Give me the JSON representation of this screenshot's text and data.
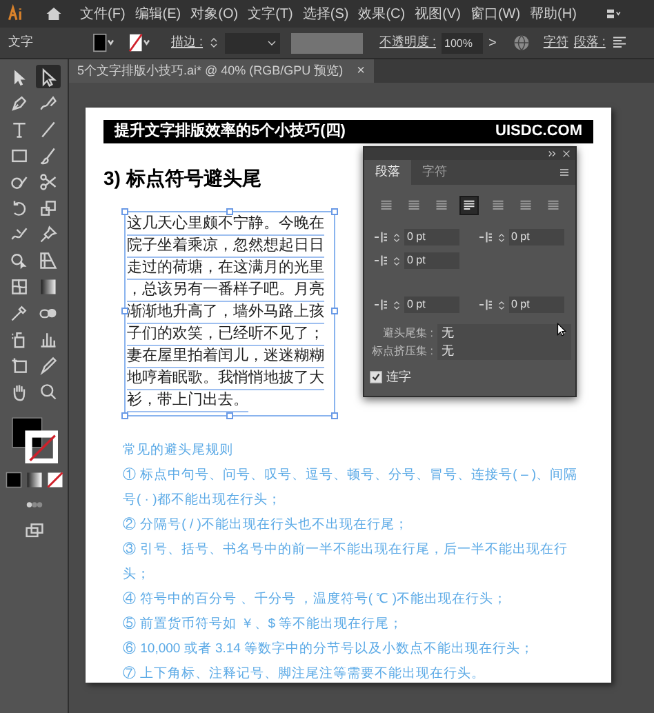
{
  "menu_bar": {
    "items": [
      "文件(F)",
      "编辑(E)",
      "对象(O)",
      "文字(T)",
      "选择(S)",
      "效果(C)",
      "视图(V)",
      "窗口(W)",
      "帮助(H)"
    ]
  },
  "control_bar": {
    "label": "文字",
    "stroke_label": "描边 :",
    "opacity_label": "不透明度 :",
    "opacity": "100%",
    "more": ">",
    "character_link": "字符",
    "paragraph_label": "段落 :"
  },
  "document_tab": {
    "title": "5个文字排版小技巧.ai* @ 40% (RGB/GPU 预览)",
    "close": "×"
  },
  "tools": [
    {
      "selected": false
    },
    {
      "selected": true
    },
    {
      "selected": false
    },
    {
      "selected": false
    },
    {
      "selected": false
    },
    {
      "selected": false
    },
    {
      "selected": false
    },
    {
      "selected": false
    },
    {
      "selected": false
    },
    {
      "selected": false
    },
    {
      "selected": false
    },
    {
      "selected": false
    },
    {
      "selected": false
    },
    {
      "selected": false
    },
    {
      "selected": false
    },
    {
      "selected": false
    },
    {
      "selected": false
    },
    {
      "selected": false
    },
    {
      "selected": false
    },
    {
      "selected": false
    },
    {
      "selected": false
    },
    {
      "selected": false
    },
    {
      "selected": false
    },
    {
      "selected": false
    },
    {
      "selected": false
    },
    {
      "selected": false
    }
  ],
  "artboard": {
    "banner_title": "提升文字排版效率的5个小技巧(四)",
    "banner_site": "UISDC.COM",
    "heading": "3) 标点符号避头尾",
    "text_frame": {
      "lines": [
        "这几天心里颇不宁静。今晚在",
        "院子坐着乘凉，忽然想起日日",
        "走过的荷塘，在这满月的光里",
        "，总该另有一番样子吧。月亮",
        "渐渐地升高了，墙外马路上孩",
        "子们的欢笑，已经听不见了；",
        "妻在屋里拍着闰儿，迷迷糊糊",
        "地哼着眠歌。我悄悄地披了大",
        "衫，带上门出去。"
      ]
    },
    "rules": {
      "title": "常见的避头尾规则",
      "items": [
        "① 标点中句号、问号、叹号、逗号、顿号、分号、冒号、连接号( – )、间隔号( · )都不能出现在行头；",
        "② 分隔号( / )不能出现在行头也不出现在行尾；",
        "③ 引号、括号、书名号中的前一半不能出现在行尾，后一半不能出现在行头；",
        "④ 符号中的百分号 、千分号 ，温度符号( ℃ )不能出现在行头；",
        "⑤ 前置货币符号如 ￥、$ 等不能出现在行尾；",
        "⑥ 10,000 或者 3.14 等数字中的分节号以及小数点不能出现在行头；",
        "⑦ 上下角标、注释记号、脚注尾注等需要不能出现在行头。"
      ]
    }
  },
  "paragraph_panel": {
    "tabs": [
      {
        "label": "段落",
        "selected": true
      },
      {
        "label": "字符",
        "selected": false
      }
    ],
    "alignments": [
      {
        "selected": false
      },
      {
        "selected": false
      },
      {
        "selected": false
      },
      {
        "selected": true
      },
      {
        "selected": false
      },
      {
        "selected": false
      },
      {
        "selected": false
      }
    ],
    "fields": [
      "0 pt",
      "0 pt",
      "0 pt",
      "0 pt",
      "0 pt"
    ],
    "dropdowns": [
      {
        "label": "避头尾集 :",
        "value": "无"
      },
      {
        "label": "标点挤压集 :",
        "value": "无"
      }
    ],
    "hyphenate": {
      "label": "连字",
      "checked": true
    }
  }
}
